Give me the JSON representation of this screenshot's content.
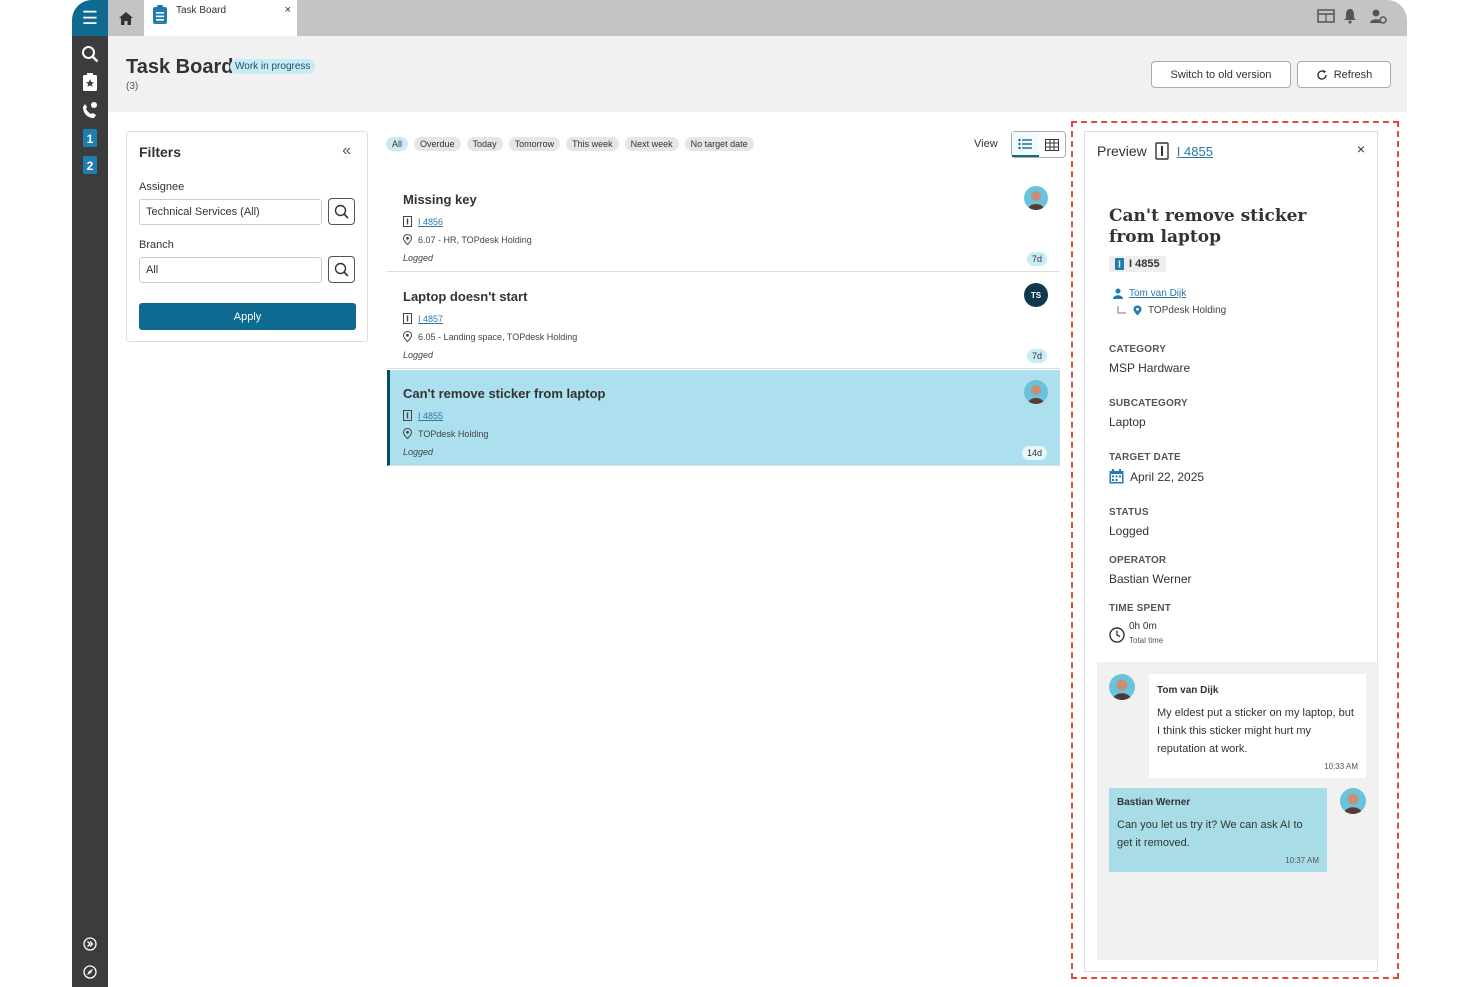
{
  "colors": {
    "brand": "#0e6a91",
    "selected_card": "#ace0ef",
    "badge": "#c8ecf6",
    "link": "#2a76a9",
    "highlight": "#e14b3b"
  },
  "topbar": {
    "tab_label": "Task Board",
    "tab_close": "×"
  },
  "header": {
    "title": "Task Board",
    "badge": "Work in progress",
    "count": "(3)",
    "switch_label": "Switch to old version",
    "refresh_label": "Refresh"
  },
  "filters": {
    "title": "Filters",
    "assignee_label": "Assignee",
    "assignee_value": "Technical Services (All)",
    "branch_label": "Branch",
    "branch_value": "All",
    "apply_label": "Apply"
  },
  "chips": [
    "All",
    "Overdue",
    "Today",
    "Tomorrow",
    "This week",
    "Next week",
    "No target date"
  ],
  "view_label": "View",
  "cards": [
    {
      "title": "Missing key",
      "id": "I 4856",
      "location": "6.07 - HR, TOPdesk Holding",
      "status": "Logged",
      "age": "7d"
    },
    {
      "title": "Laptop doesn't start",
      "id": "I 4857",
      "location": "6.05 - Landing space, TOPdesk Holding",
      "status": "Logged",
      "age": "7d",
      "initials": "TS"
    },
    {
      "title": "Can't remove sticker from laptop",
      "id": "I 4855",
      "location": "TOPdesk Holding",
      "status": "Logged",
      "age": "14d"
    }
  ],
  "preview": {
    "label": "Preview",
    "id": "I 4855",
    "close": "×",
    "title": "Can't remove sticker from laptop",
    "badge_id": "I 4855",
    "person": "Tom van Dijk",
    "branch": "TOPdesk Holding",
    "category_label": "CATEGORY",
    "category": "MSP Hardware",
    "subcategory_label": "SUBCATEGORY",
    "subcategory": "Laptop",
    "target_label": "TARGET DATE",
    "target": "April 22, 2025",
    "status_label": "STATUS",
    "status": "Logged",
    "operator_label": "OPERATOR",
    "operator": "Bastian Werner",
    "time_label": "TIME SPENT",
    "time": "0h 0m",
    "time_sub": "Total time"
  },
  "chat": [
    {
      "author": "Tom van Dijk",
      "text": "My eldest put a sticker on my laptop, but I think this sticker might hurt my reputation at work.",
      "time": "10:33 AM"
    },
    {
      "author": "Bastian Werner",
      "text": "Can you let us try it? We can ask AI to get it removed.",
      "time": "10:37 AM"
    }
  ]
}
